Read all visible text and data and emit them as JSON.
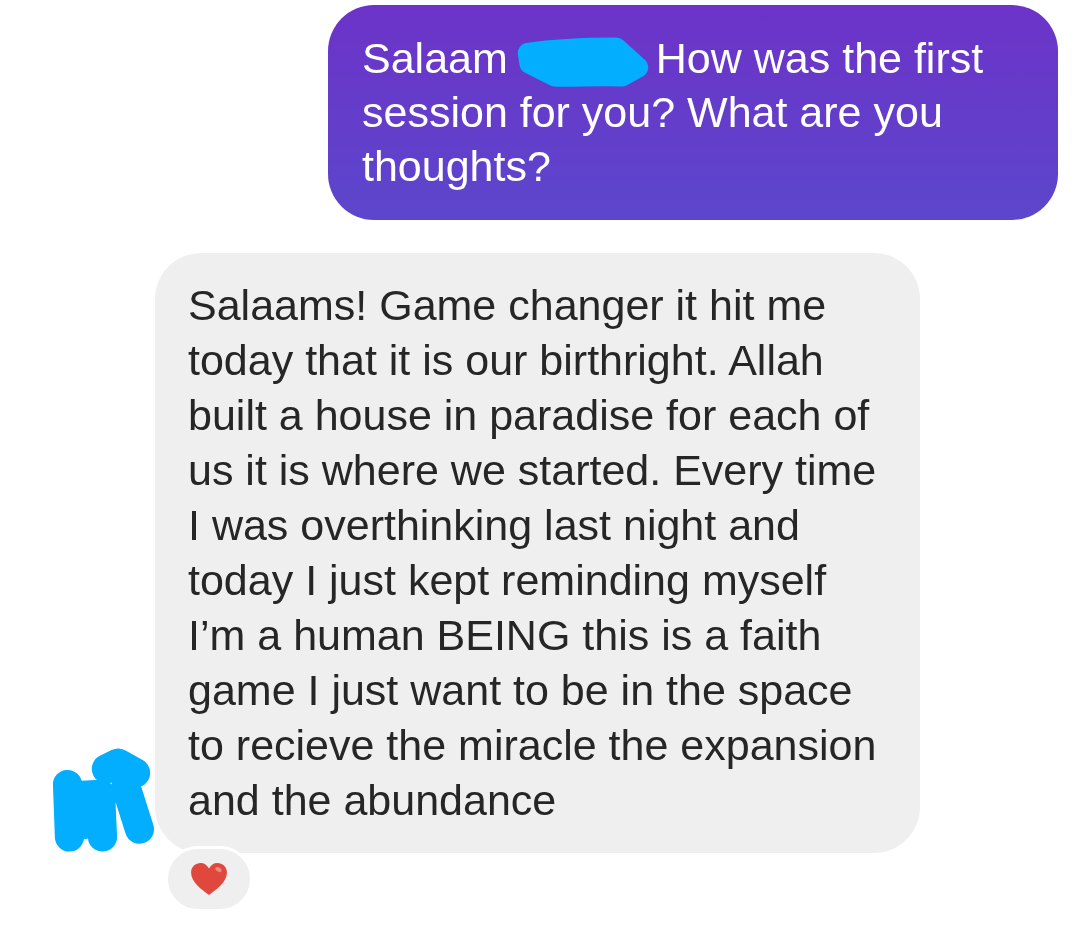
{
  "messages": [
    {
      "kind": "outgoing",
      "greeting": "Salaam",
      "name_redacted": true,
      "text": "How was the first session for you? What are you thoughts?"
    },
    {
      "kind": "incoming",
      "avatar_redacted": true,
      "text": "Salaams! Game changer it hit me today that it is our birthright. Allah built a house in paradise for each of us it is where we started. Every time I was overthinking last night and today I just kept reminding myself I’m a human BEING this is a faith game I just want to be in the space to recieve the miracle the expansion and the abundance",
      "reactions": [
        {
          "kind": "heart"
        }
      ]
    }
  ]
}
